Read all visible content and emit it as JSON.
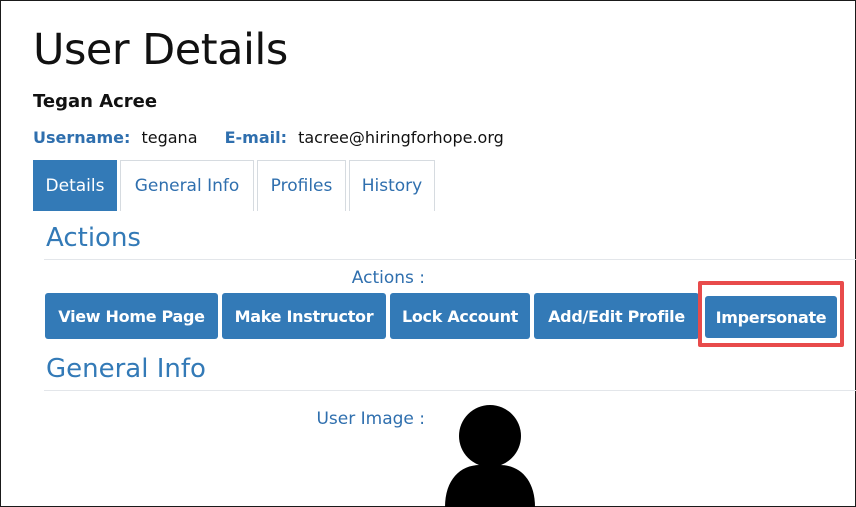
{
  "page": {
    "title": "User Details",
    "user_name": "Tegan Acree",
    "username_label": "Username:",
    "username_value": "tegana",
    "email_label": "E-mail:",
    "email_value": "tacree@hiringforhope.org"
  },
  "tabs": [
    {
      "label": "Details",
      "active": true
    },
    {
      "label": "General Info",
      "active": false
    },
    {
      "label": "Profiles",
      "active": false
    },
    {
      "label": "History",
      "active": false
    }
  ],
  "actions_section": {
    "title": "Actions",
    "field_label": "Actions :",
    "buttons": [
      {
        "label": "View Home Page"
      },
      {
        "label": "Make Instructor"
      },
      {
        "label": "Lock Account"
      },
      {
        "label": "Add/Edit Profile"
      },
      {
        "label": "Impersonate",
        "highlighted": true
      }
    ]
  },
  "general_info_section": {
    "title": "General Info",
    "user_image_label": "User Image :",
    "avatar_icon": "user-silhouette-icon"
  },
  "colors": {
    "primary": "#337ab7",
    "link": "#2f6fae",
    "highlight": "#e84b4b"
  }
}
